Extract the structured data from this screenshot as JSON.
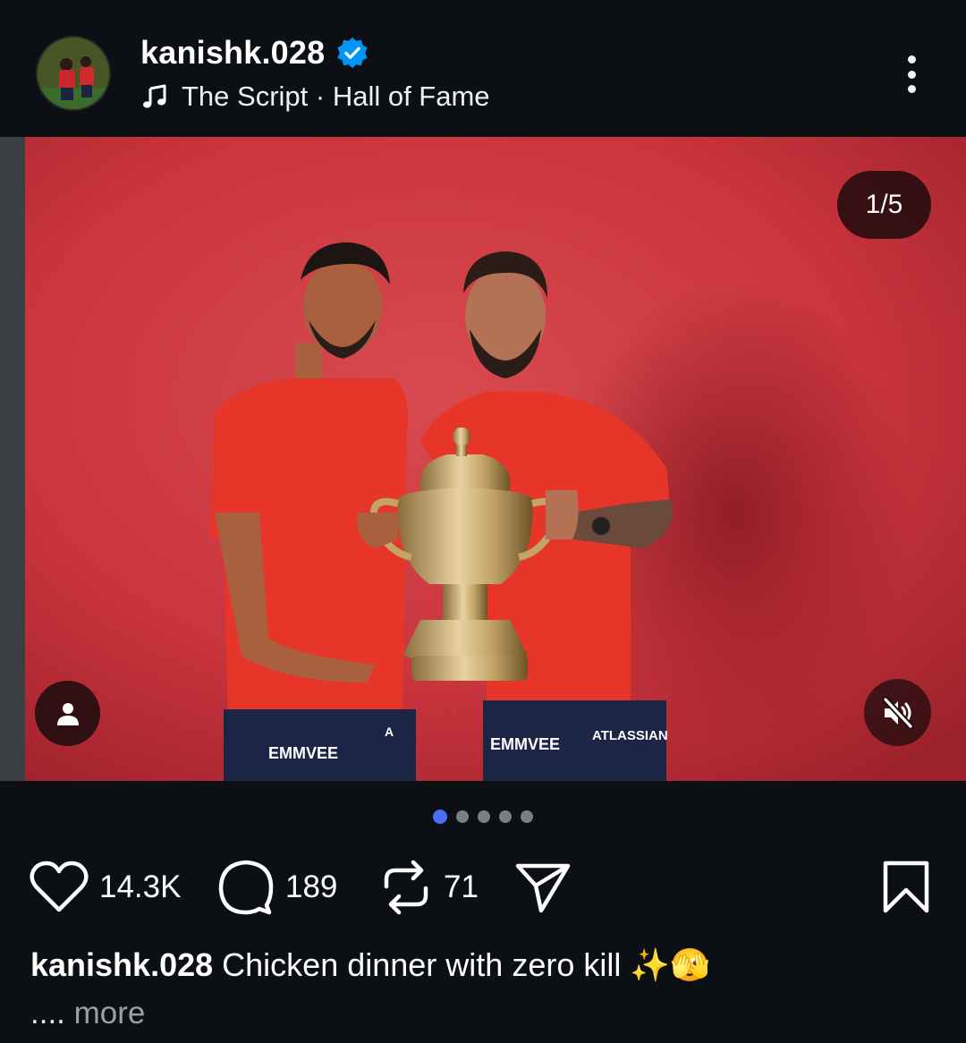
{
  "header": {
    "username": "kanishk.028",
    "music": "The Script · Hall of Fame"
  },
  "media": {
    "counter": "1/5",
    "jersey_left_text": "EMMVEE",
    "jersey_right_text": "EMMVEE",
    "sponsor_right": "ATLASSIAN",
    "sponsor_left": "A"
  },
  "carousel": {
    "total": 5,
    "active": 1
  },
  "actions": {
    "likes": "14.3K",
    "comments": "189",
    "reposts": "71"
  },
  "caption": {
    "username": "kanishk.028",
    "text": "Chicken dinner with zero kill ✨🫣",
    "ellipsis": "....",
    "more": "more"
  },
  "colors": {
    "background": "#0c1014",
    "backdrop_red": "#c9343d",
    "jersey_red": "#e8352a",
    "verified_blue": "#0095f6",
    "active_dot": "#4c6ef5"
  }
}
